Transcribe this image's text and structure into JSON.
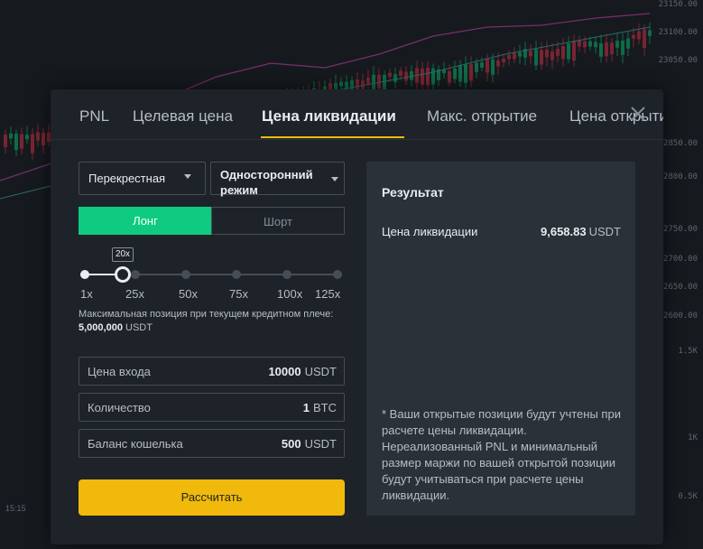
{
  "background": {
    "price_axis": [
      "23150.00",
      "23100.00",
      "23050.00",
      "22850.00",
      "22800.00",
      "22750.00",
      "22700.00",
      "22650.00",
      "22600.00",
      "1.5K",
      "1K",
      "0.5K"
    ],
    "time_label": "15:15"
  },
  "tabs": [
    {
      "label": "PNL",
      "active": false
    },
    {
      "label": "Целевая цена",
      "active": false
    },
    {
      "label": "Цена ликвидации",
      "active": true
    },
    {
      "label": "Макс. открытие",
      "active": false
    },
    {
      "label": "Цена открытия",
      "active": false
    }
  ],
  "margin_mode": {
    "value": "Перекрестная"
  },
  "position_mode": {
    "value": "Односторонний режим"
  },
  "side": {
    "long_label": "Лонг",
    "short_label": "Шорт",
    "selected": "long"
  },
  "leverage": {
    "current_label": "20x",
    "current": 20,
    "ticks": [
      "1x",
      "25x",
      "50x",
      "75x",
      "100x",
      "125x"
    ]
  },
  "max_position": {
    "text": "Максимальная позиция при текущем кредитном плече:",
    "value": "5,000,000",
    "unit": "USDT"
  },
  "fields": {
    "entry": {
      "label": "Цена входа",
      "value": "10000",
      "unit": "USDT"
    },
    "quantity": {
      "label": "Количество",
      "value": "1",
      "unit": "BTC"
    },
    "balance": {
      "label": "Баланс кошелька",
      "value": "500",
      "unit": "USDT"
    }
  },
  "calculate_label": "Рассчитать",
  "result": {
    "title": "Результат",
    "row_label": "Цена ликвидации",
    "row_value": "9,658.83",
    "row_unit": "USDT",
    "note": "* Ваши открытые позиции будут учтены при расчете цены ликвидации. Нереализованный PNL и минимальный размер маржи по вашей открытой позиции будут учитываться при расчете цены ликвидации."
  },
  "colors": {
    "accent": "#f0b90b",
    "long": "#0ecb81",
    "short": "#f6465d",
    "panel": "#1e2329",
    "result_panel": "#2b3139"
  }
}
